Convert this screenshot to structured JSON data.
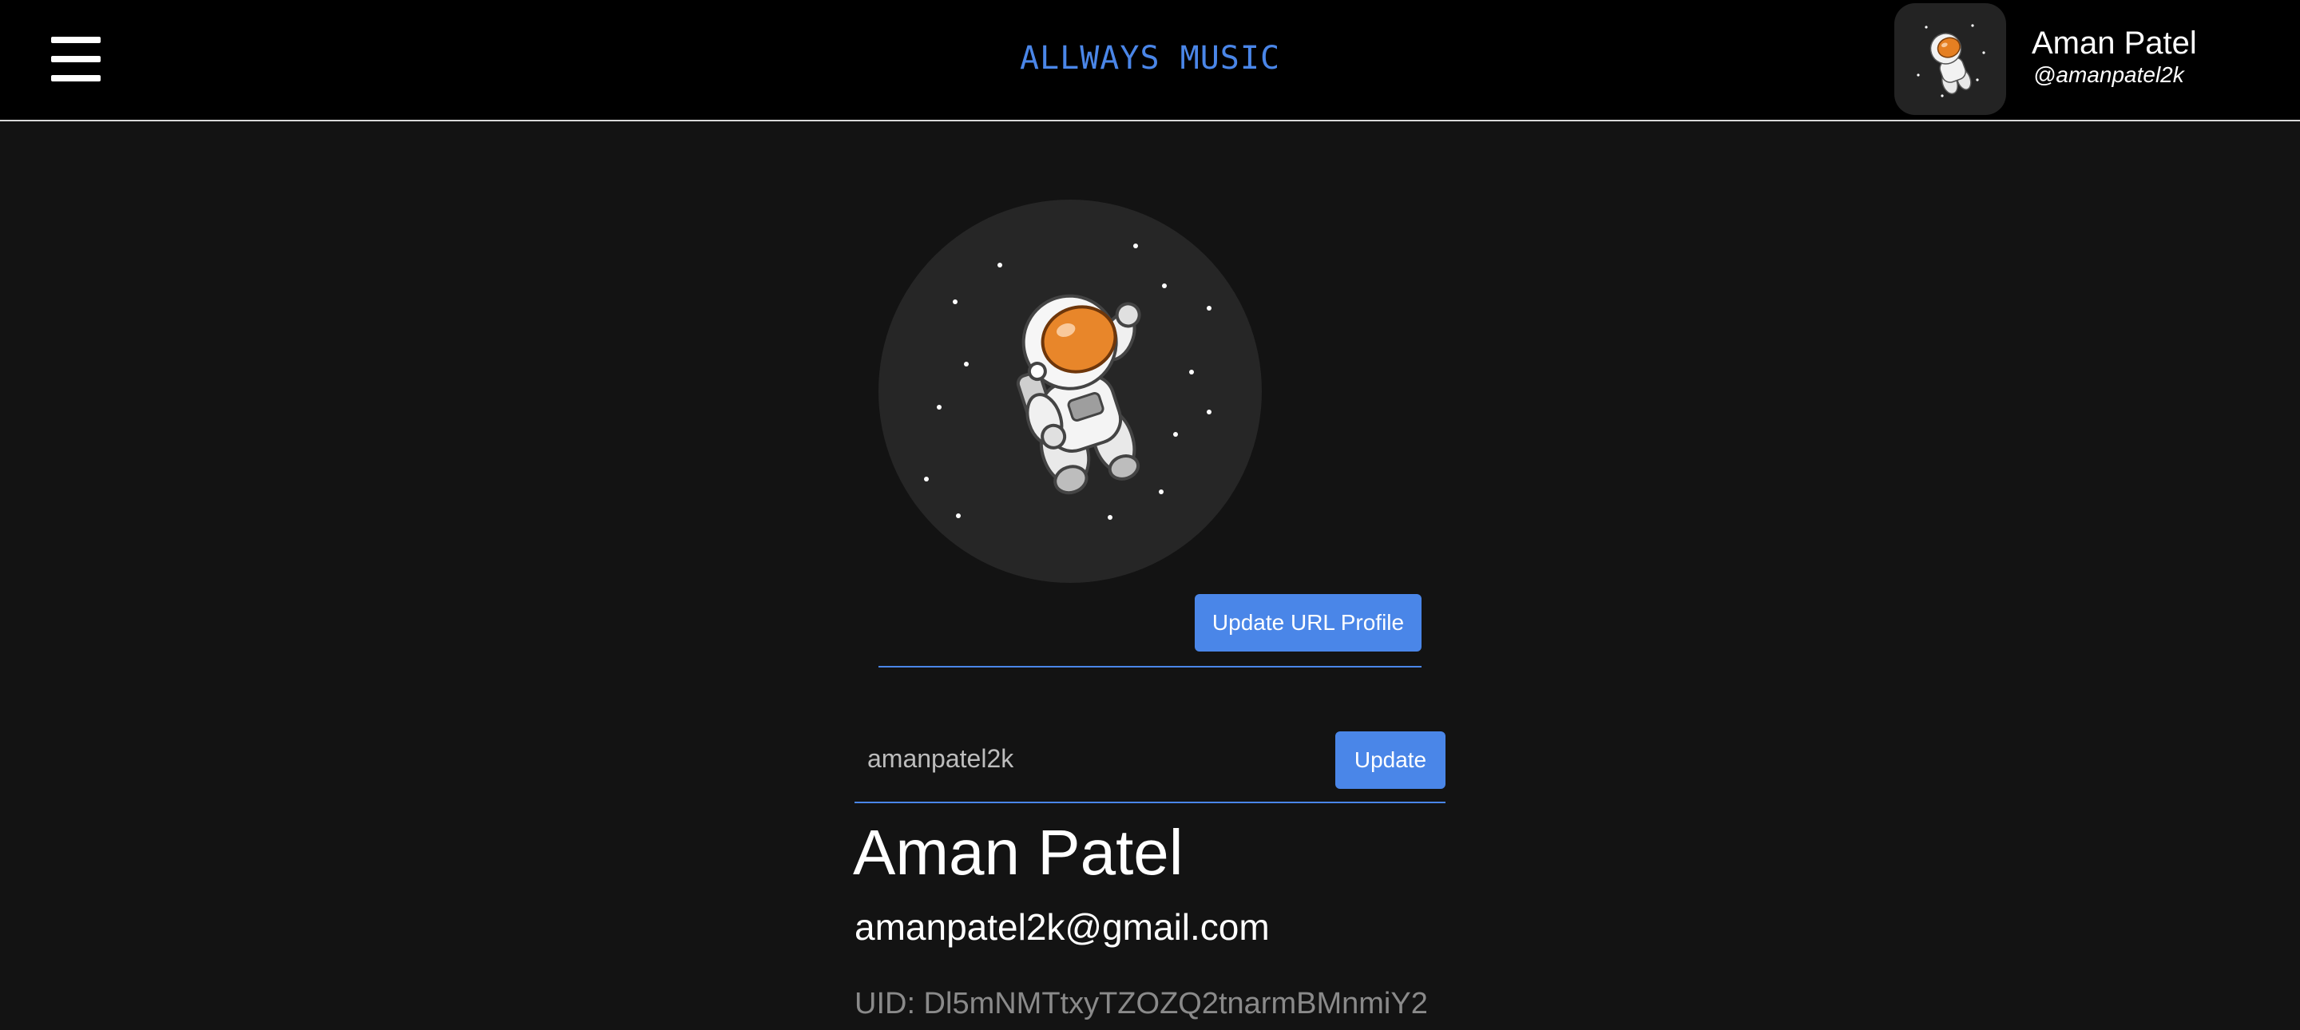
{
  "header": {
    "brand": "ALLWAYS MUSIC",
    "menu_icon": "hamburger-menu-icon",
    "user": {
      "name": "Aman Patel",
      "handle": "@amanpatel2k",
      "avatar_icon": "astronaut-avatar"
    }
  },
  "profile": {
    "avatar_icon": "astronaut-avatar",
    "url_input": {
      "value": "",
      "placeholder": ""
    },
    "url_button_label": "Update URL Profile",
    "username_input": {
      "value": "amanpatel2k"
    },
    "username_button_label": "Update",
    "display_name": "Aman Patel",
    "email": "amanpatel2k@gmail.com",
    "uid": "UID: Dl5mNMTtxyTZOZQ2tnarmBMnmiY2"
  },
  "colors": {
    "accent": "#4a86e8",
    "background": "#131313",
    "header_bg": "#000000"
  }
}
